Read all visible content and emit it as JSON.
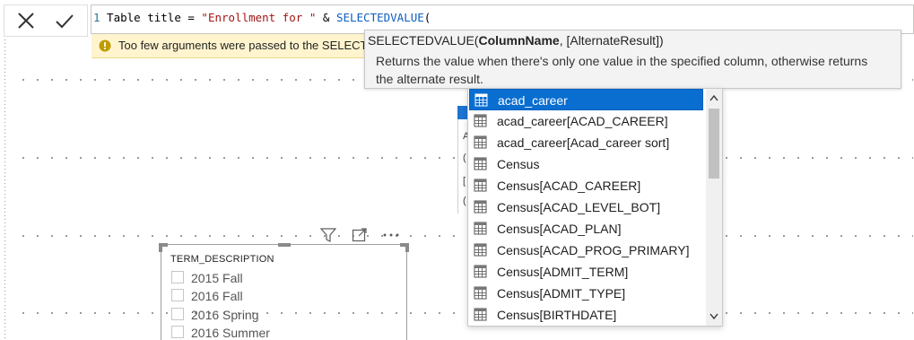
{
  "formula": {
    "line_number": "1",
    "part1": " Table title = ",
    "string": "\"Enrollment for \"",
    "part2": " & ",
    "function": "SELECTEDVALUE",
    "part3": "("
  },
  "warning": {
    "text": "Too few arguments were passed to the SELECTEDVALUE function. The minimum argument count for the function is 1.",
    "icon": "warning-icon"
  },
  "signature": {
    "fn": "SELECTEDVALUE(",
    "param_bold": "ColumnName",
    "rest": ", [AlternateResult])",
    "description": "Returns the value when there's only one value in the specified column, otherwise returns the alternate result."
  },
  "slicer": {
    "title": "TERM_DESCRIPTION",
    "options": [
      "2015 Fall",
      "2016 Fall",
      "2016 Spring",
      "2016 Summer"
    ]
  },
  "background_visual_chars": [
    "A",
    "(",
    "[",
    "("
  ],
  "autocomplete": {
    "items": [
      {
        "label": "acad_career",
        "icon": "table-icon",
        "selected": true
      },
      {
        "label": "acad_career[ACAD_CAREER]",
        "icon": "column-icon"
      },
      {
        "label": "acad_career[Acad_career sort]",
        "icon": "column-icon"
      },
      {
        "label": "Census",
        "icon": "table-icon"
      },
      {
        "label": "Census[ACAD_CAREER]",
        "icon": "column-icon"
      },
      {
        "label": "Census[ACAD_LEVEL_BOT]",
        "icon": "column-icon"
      },
      {
        "label": "Census[ACAD_PLAN]",
        "icon": "column-icon"
      },
      {
        "label": "Census[ACAD_PROG_PRIMARY]",
        "icon": "column-icon"
      },
      {
        "label": "Census[ADMIT_TERM]",
        "icon": "column-icon"
      },
      {
        "label": "Census[ADMIT_TYPE]",
        "icon": "column-icon"
      },
      {
        "label": "Census[BIRTHDATE]",
        "icon": "column-icon"
      }
    ]
  },
  "colors": {
    "selection": "#0a6ed1",
    "warning_bg": "#fff4ce",
    "function_token": "#0d5fbf",
    "string_token": "#a31515"
  }
}
